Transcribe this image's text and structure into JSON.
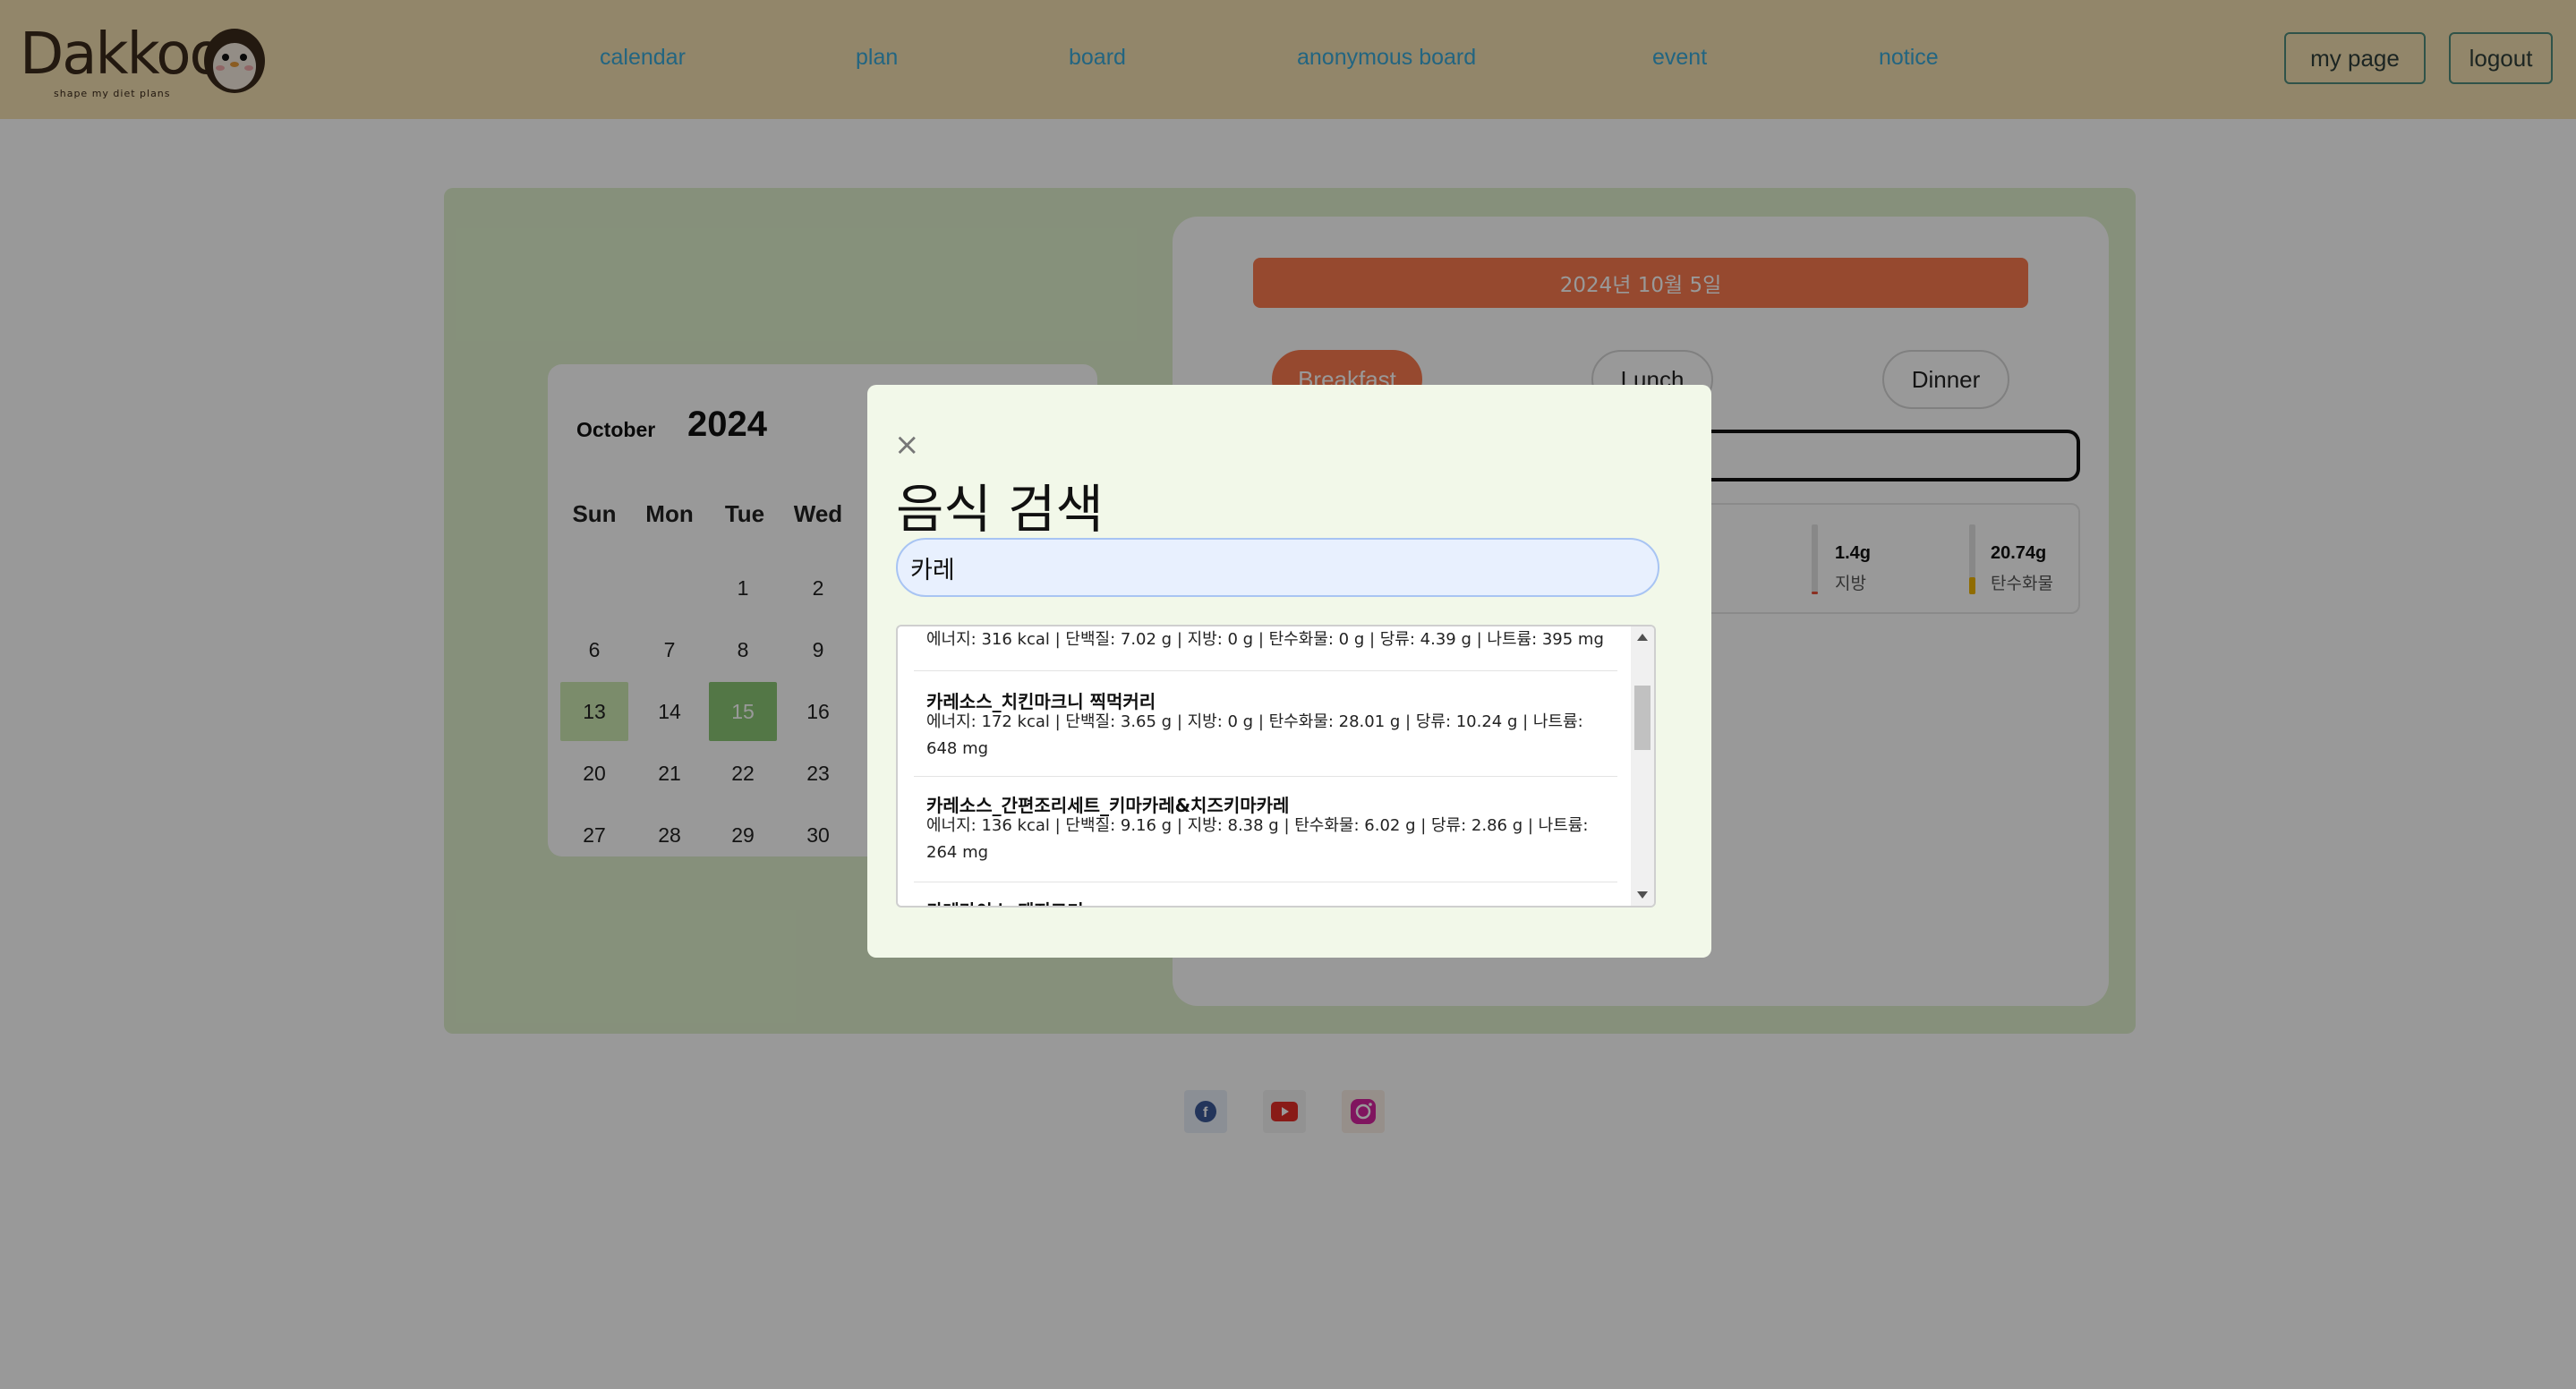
{
  "header": {
    "logo_text": "Dakkoo",
    "logo_tagline": "shape my diet plans",
    "nav": [
      "calendar",
      "plan",
      "board",
      "anonymous board",
      "event",
      "notice"
    ],
    "my_page": "my page",
    "logout": "logout"
  },
  "calendar": {
    "month": "October",
    "year": "2024",
    "weekdays": [
      "Sun",
      "Mon",
      "Tue",
      "Wed"
    ],
    "weeks": [
      [
        "",
        "",
        "1",
        "2"
      ],
      [
        "6",
        "7",
        "8",
        "9"
      ],
      [
        "13",
        "14",
        "15",
        "16"
      ],
      [
        "20",
        "21",
        "22",
        "23"
      ],
      [
        "27",
        "28",
        "29",
        "30"
      ]
    ],
    "highlighted_light": "13",
    "highlighted_dark": "15"
  },
  "plan": {
    "date": "2024년 10월 5일",
    "meals": [
      "Breakfast",
      "Lunch",
      "Dinner"
    ],
    "active_meal": "Breakfast",
    "nutrients": [
      {
        "value": "1.4g",
        "label": "지방",
        "fill": 0.04,
        "color": "#e8503a"
      },
      {
        "value": "20.74g",
        "label": "탄수화물",
        "fill": 0.25,
        "color": "#f0b400"
      }
    ]
  },
  "social": [
    "facebook-icon",
    "youtube-icon",
    "instagram-icon"
  ],
  "modal": {
    "close": "×",
    "title": "음식 검색",
    "search_value": "카레",
    "results": [
      {
        "name": "",
        "info": "에너지: 316 kcal | 단백질: 7.02 g | 지방: 0 g | 탄수화물: 0 g | 당류: 4.39 g | 나트륨: 395 mg"
      },
      {
        "name": "카레소스_치킨마크니 찍먹커리",
        "info": "에너지: 172 kcal | 단백질: 3.65 g | 지방: 0 g | 탄수화물: 28.01 g | 당류: 10.24 g | 나트륨: 648 mg"
      },
      {
        "name": "카레소스_간편조리세트_키마카레&치즈키마카레",
        "info": "에너지: 136 kcal | 단백질: 9.16 g | 지방: 8.38 g | 탄수화물: 6.02 g | 당류: 2.86 g | 나트륨: 264 mg"
      },
      {
        "name": "카레라이스_돼지고기",
        "info": ""
      }
    ]
  }
}
